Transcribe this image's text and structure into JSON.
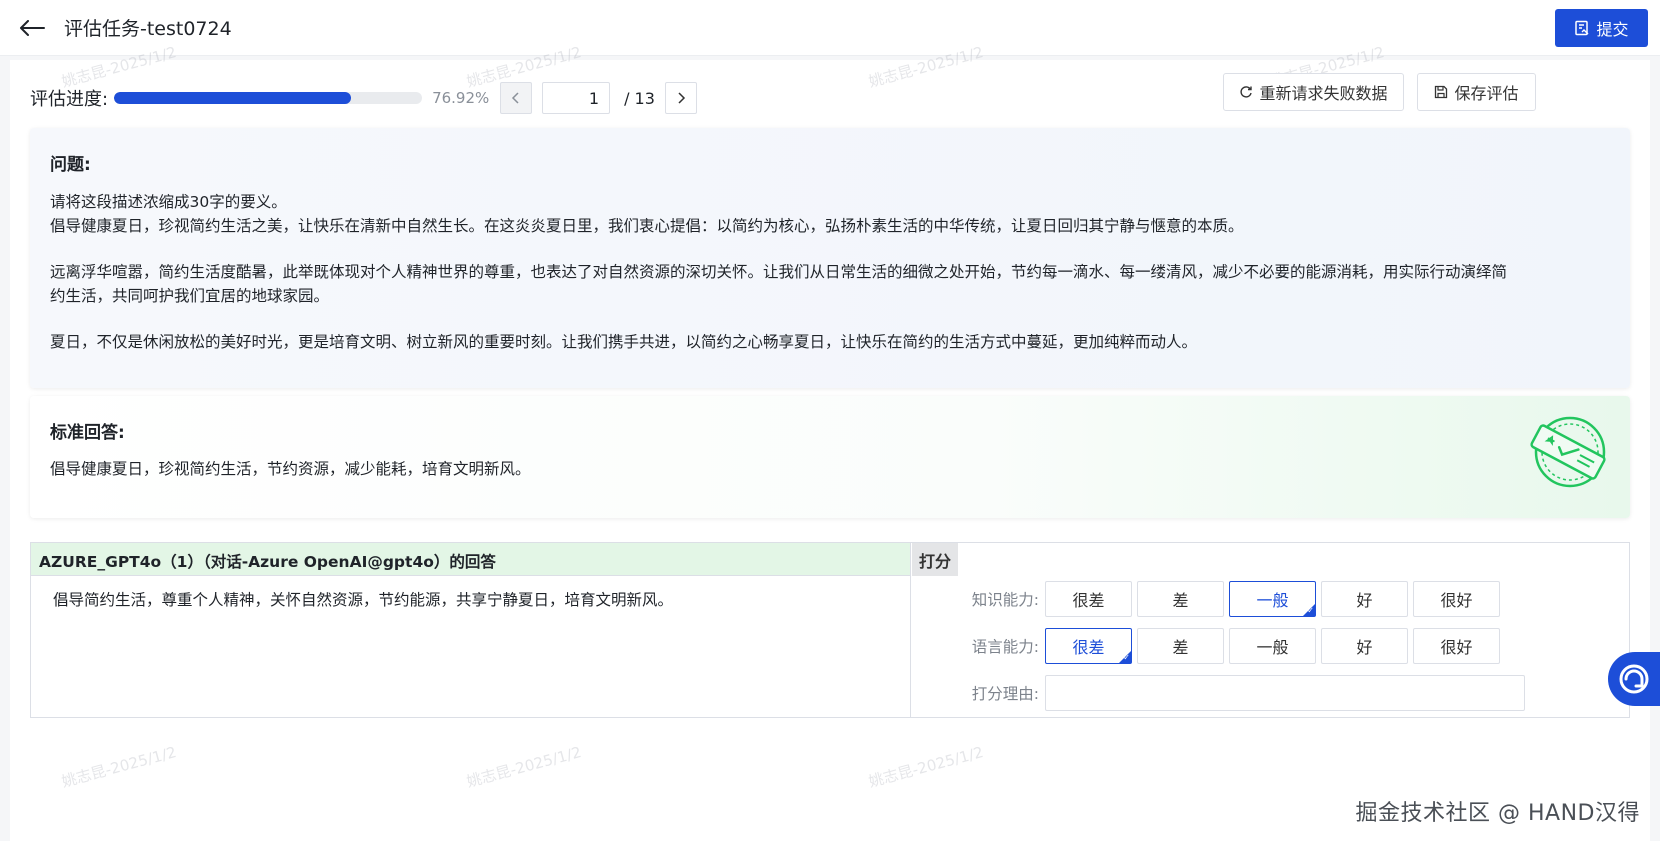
{
  "header": {
    "title": "评估任务-test0724",
    "submit_label": "提交"
  },
  "progress": {
    "label": "评估进度:",
    "percent_text": "76.92%",
    "fraction": 0.7692,
    "current_page": "1",
    "total_text": "/ 13"
  },
  "actions": {
    "retry_label": "重新请求失败数据",
    "save_label": "保存评估"
  },
  "question": {
    "heading": "问题:",
    "lines": [
      "请将这段描述浓缩成30字的要义。",
      "倡导健康夏日，珍视简约生活之美，让快乐在清新中自然生长。在这炎炎夏日里，我们衷心提倡：以简约为核心，弘扬朴素生活的中华传统，让夏日回归其宁静与惬意的本质。",
      "远离浮华喧嚣，简约生活度酷暑，此举既体现对个人精神世界的尊重，也表达了对自然资源的深切关怀。让我们从日常生活的细微之处开始，节约每一滴水、每一缕清风，减少不必要的能源消耗，用实际行动演绎简",
      "约生活，共同呵护我们宜居的地球家园。",
      "夏日，不仅是休闲放松的美好时光，更是培育文明、树立新风的重要时刻。让我们携手共进，以简约之心畅享夏日，让快乐在简约的生活方式中蔓延，更加纯粹而动人。"
    ]
  },
  "standard_answer": {
    "heading": "标准回答:",
    "text": "倡导健康夏日，珍视简约生活，节约资源，减少能耗，培育文明新风。"
  },
  "model": {
    "header": "AZURE_GPT4o（1）（对话-Azure OpenAI@gpt4o）的回答",
    "answer": "倡导简约生活，尊重个人精神，关怀自然资源，节约能源，共享宁静夏日，培育文明新风。"
  },
  "scoring": {
    "heading": "打分",
    "options": [
      "很差",
      "差",
      "一般",
      "好",
      "很好"
    ],
    "rows": [
      {
        "label": "知识能力:",
        "selected": 2
      },
      {
        "label": "语言能力:",
        "selected": 0
      }
    ],
    "reason_label": "打分理由:",
    "reason_value": ""
  },
  "watermark": "姚志昆-2025/1/2",
  "footer_brand": "掘金技术社区 @ HAND汉得",
  "colors": {
    "primary": "#1d4ed8",
    "model_header_bg": "#e3f6e6",
    "stamp_green": "#22c55e"
  }
}
